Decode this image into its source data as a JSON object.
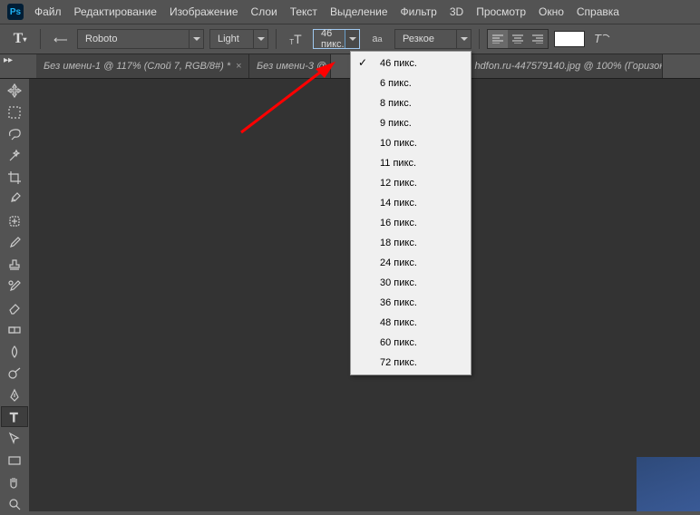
{
  "menu": {
    "file": "Файл",
    "edit": "Редактирование",
    "image": "Изображение",
    "layer": "Слои",
    "type": "Текст",
    "select": "Выделение",
    "filter": "Фильтр",
    "threeD": "3D",
    "view": "Просмотр",
    "window": "Окно",
    "help": "Справка"
  },
  "options": {
    "font": "Roboto",
    "weight": "Light",
    "size": "46 пикс.",
    "aa": "Резкое"
  },
  "tabs": {
    "t1": "Без имени-1 @ 117% (Слой 7, RGB/8#) *",
    "t2": "Без имени-3 @",
    "t3": "hdfon.ru-447579140.jpg @ 100% (Горизон"
  },
  "sizeMenu": {
    "i0": "46 пикс.",
    "i1": "6 пикс.",
    "i2": "8 пикс.",
    "i3": "9 пикс.",
    "i4": "10 пикс.",
    "i5": "11 пикс.",
    "i6": "12 пикс.",
    "i7": "14 пикс.",
    "i8": "16 пикс.",
    "i9": "18 пикс.",
    "i10": "24 пикс.",
    "i11": "30 пикс.",
    "i12": "36 пикс.",
    "i13": "48 пикс.",
    "i14": "60 пикс.",
    "i15": "72 пикс."
  },
  "logo": "Ps",
  "checkmark": "✓"
}
